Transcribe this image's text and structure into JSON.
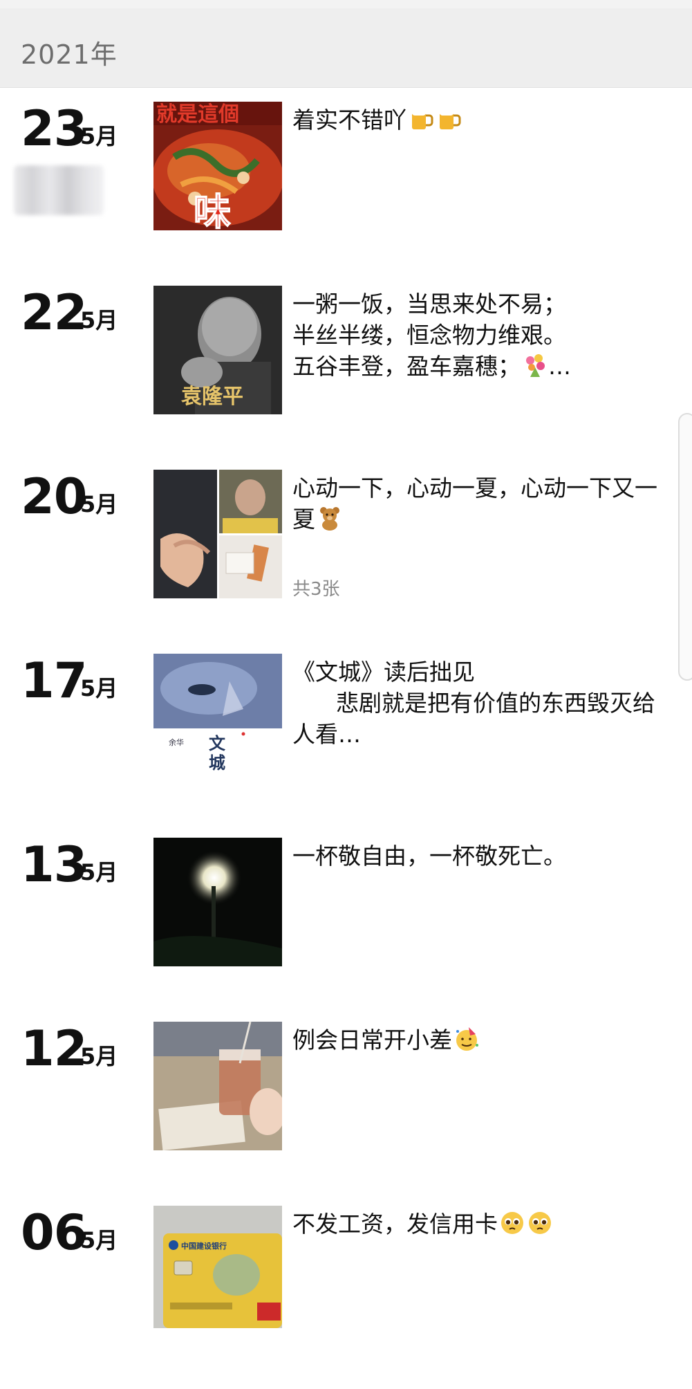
{
  "header": {
    "year": "2021年"
  },
  "posts": [
    {
      "day": "23",
      "month": "5月",
      "text": "着实不错吖",
      "thumb_text": [
        "就是這個",
        "味"
      ],
      "emoji": [
        "beer-mug",
        "beer-mug"
      ]
    },
    {
      "day": "22",
      "month": "5月",
      "text": "一粥一饭，当思来处不易；\n半丝半缕，恒念物力维艰。\n五谷丰登，盈车嘉穗；",
      "suffix": "…",
      "thumb_text": [
        "袁隆平"
      ],
      "emoji": [
        "flower-bouquet"
      ]
    },
    {
      "day": "20",
      "month": "5月",
      "text": "心动一下，心动一夏，心动一下又一夏",
      "photo_count": "共3张",
      "emoji": [
        "teddy-bear"
      ]
    },
    {
      "day": "17",
      "month": "5月",
      "text": "《文城》读后拙见\n      悲剧就是把有价值的东西毁灭给人看…",
      "thumb_text": [
        "文",
        "城",
        "余华"
      ]
    },
    {
      "day": "13",
      "month": "5月",
      "text": "一杯敬自由，一杯敬死亡。"
    },
    {
      "day": "12",
      "month": "5月",
      "text": "例会日常开小差",
      "emoji": [
        "party-face"
      ]
    },
    {
      "day": "06",
      "month": "5月",
      "text": "不发工资，发信用卡",
      "thumb_text": [
        "中国建设银行"
      ],
      "emoji": [
        "pleading-face",
        "pleading-face"
      ]
    }
  ],
  "colors": {
    "header_bg": "#eeeeee",
    "year_text": "#6d6d6d",
    "count_text": "#8a8a8a"
  }
}
